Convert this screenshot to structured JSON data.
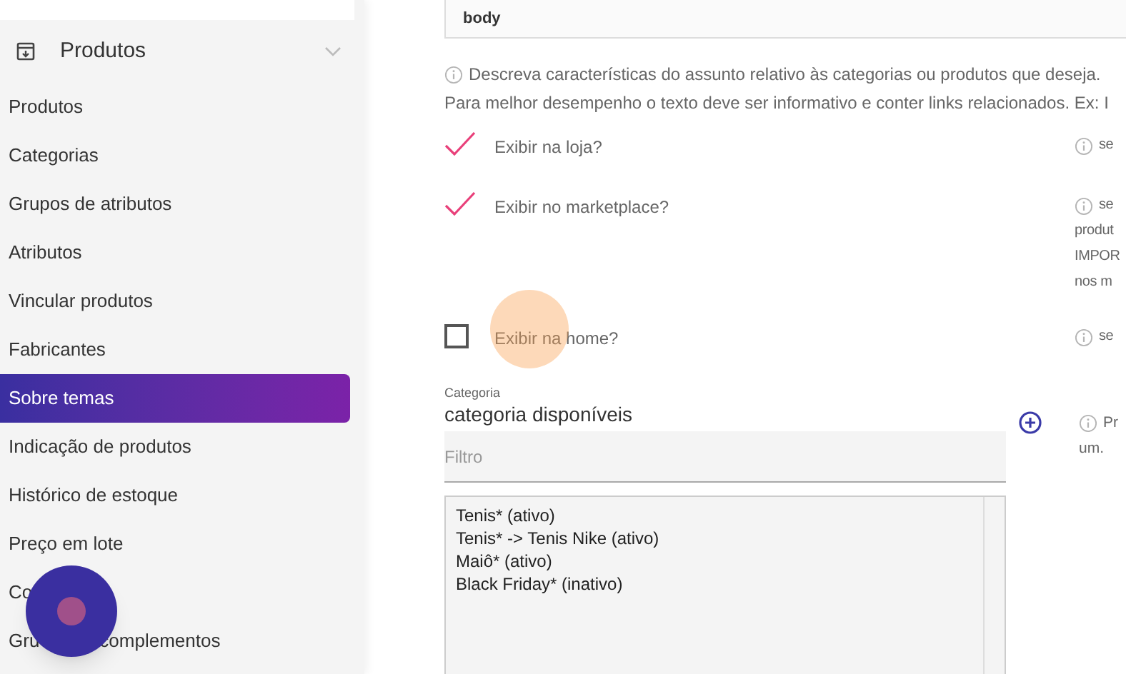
{
  "sidebar": {
    "section": {
      "label": "Produtos",
      "expanded": true
    },
    "items": [
      {
        "label": "Produtos",
        "selected": false
      },
      {
        "label": "Categorias",
        "selected": false
      },
      {
        "label": "Grupos de atributos",
        "selected": false
      },
      {
        "label": "Atributos",
        "selected": false
      },
      {
        "label": "Vincular produtos",
        "selected": false
      },
      {
        "label": "Fabricantes",
        "selected": false
      },
      {
        "label": "Sobre temas",
        "selected": true
      },
      {
        "label": "Indicação de produtos",
        "selected": false
      },
      {
        "label": "Histórico de estoque",
        "selected": false
      },
      {
        "label": "Preço em lote",
        "selected": false
      },
      {
        "label": "Co",
        "selected": false
      },
      {
        "label": "Gru",
        "label_after": "complementos",
        "selected": false
      }
    ]
  },
  "form": {
    "body_field": {
      "value": "body"
    },
    "description_hint": [
      "Descreva características do assunto relativo às categorias ou produtos que deseja.",
      "Para melhor desempenho o texto deve ser informativo e conter links relacionados. Ex: I"
    ],
    "options": [
      {
        "label": "Exibir na loja?",
        "checked": true,
        "help": [
          "se"
        ]
      },
      {
        "label": "Exibir no marketplace?",
        "checked": true,
        "help": [
          "se",
          "produt",
          "IMPOR",
          "nos m"
        ]
      },
      {
        "label": "Exibir na home?",
        "checked": false,
        "help": [
          "se"
        ]
      }
    ],
    "category": {
      "label": "Categoria",
      "title": "categoria disponíveis",
      "filter_placeholder": "Filtro",
      "help": [
        "Pr",
        "um."
      ],
      "list": [
        "Tenis* (ativo)",
        "Tenis* -> Tenis Nike (ativo)",
        "Maiô* (ativo)",
        "Black Friday* (inativo)"
      ]
    }
  }
}
